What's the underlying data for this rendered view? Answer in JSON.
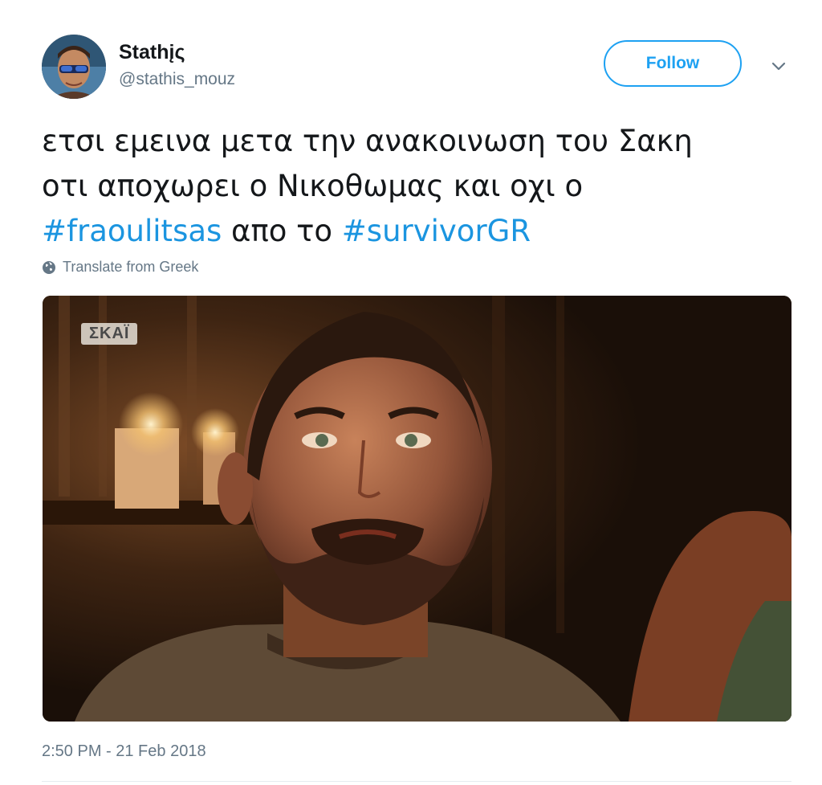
{
  "user": {
    "display_name": "Stathįς",
    "handle": "@stathis_mouz"
  },
  "follow_label": "Follow",
  "tweet": {
    "line1": "ετσι εμεινα μετα την ανακοινωση του Σακη",
    "line2": "οτι αποχωρει ο Νικοθωμας και οχι ο",
    "hashtag1": "#fraoulitsas",
    "middle": " απο το ",
    "hashtag2": "#survivorGR"
  },
  "translate_label": "Translate from Greek",
  "media": {
    "channel_logo": "ΣΚΑΪ"
  },
  "timestamp": "2:50 PM - 21 Feb 2018",
  "colors": {
    "accent": "#1da1f2",
    "link": "#1b95e0",
    "muted": "#657786"
  },
  "icons": {
    "globe": "globe-icon",
    "chevron": "chevron-down-icon"
  }
}
